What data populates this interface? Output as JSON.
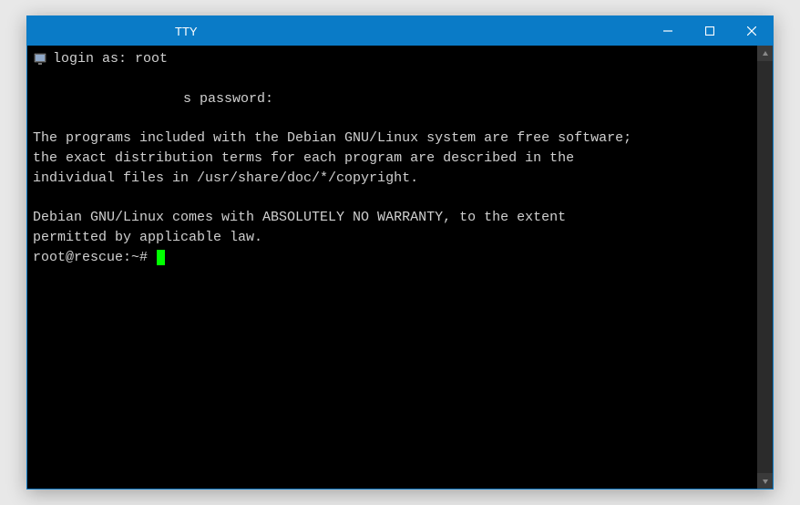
{
  "window": {
    "title_suffix": "TTY"
  },
  "terminal": {
    "login_prompt": "login as:",
    "login_user": "root",
    "password_suffix": "s password:",
    "motd_line1": "The programs included with the Debian GNU/Linux system are free software;",
    "motd_line2": "the exact distribution terms for each program are described in the",
    "motd_line3": "individual files in /usr/share/doc/*/copyright.",
    "motd_line4": "Debian GNU/Linux comes with ABSOLUTELY NO WARRANTY, to the extent",
    "motd_line5": "permitted by applicable law.",
    "prompt": "root@rescue:~#"
  }
}
